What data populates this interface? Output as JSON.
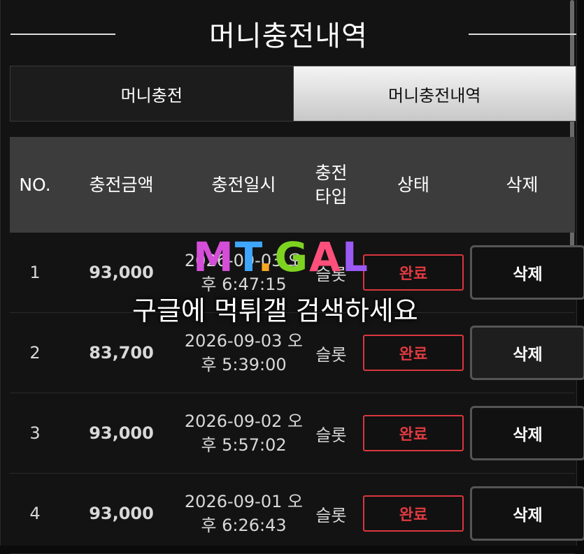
{
  "page": {
    "title": "머니충전내역"
  },
  "tabs": [
    {
      "label": "머니충전",
      "active": false
    },
    {
      "label": "머니충전내역",
      "active": true
    }
  ],
  "table": {
    "headers": {
      "no": "NO.",
      "amount": "충전금액",
      "datetime": "충전일시",
      "type_line1": "충전",
      "type_line2": "타입",
      "status": "상태",
      "delete": "삭제"
    },
    "rows": [
      {
        "no": "1",
        "amount": "93,000",
        "date_line1": "2026-09-03 오",
        "date_line2": "후 6:47:15",
        "type": "슬롯",
        "status": "완료",
        "delete": "삭제"
      },
      {
        "no": "2",
        "amount": "83,700",
        "date_line1": "2026-09-03 오",
        "date_line2": "후 5:39:00",
        "type": "슬롯",
        "status": "완료",
        "delete": "삭제"
      },
      {
        "no": "3",
        "amount": "93,000",
        "date_line1": "2026-09-02 오",
        "date_line2": "후 5:57:02",
        "type": "슬롯",
        "status": "완료",
        "delete": "삭제"
      },
      {
        "no": "4",
        "amount": "93,000",
        "date_line1": "2026-09-01 오",
        "date_line2": "후 6:26:43",
        "type": "슬롯",
        "status": "완료",
        "delete": "삭제"
      }
    ]
  },
  "watermark": {
    "logo": "MTGAL",
    "text": "구글에 먹튀갤 검색하세요"
  },
  "colors": {
    "amount": "#f3c61e",
    "status": "#e03a40",
    "header_bg": "#3c3c3c"
  }
}
